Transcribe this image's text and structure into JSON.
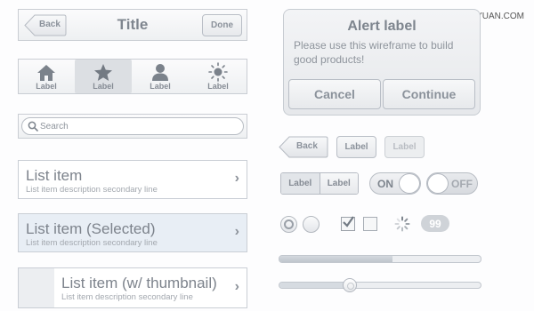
{
  "navbar": {
    "back_label": "Back",
    "title": "Title",
    "done_label": "Done"
  },
  "tabbar": {
    "tabs": [
      {
        "label": "Label",
        "icon": "home-icon"
      },
      {
        "label": "Label",
        "icon": "star-icon"
      },
      {
        "label": "Label",
        "icon": "person-icon"
      },
      {
        "label": "Label",
        "icon": "sun-icon"
      }
    ]
  },
  "search": {
    "placeholder": "Search"
  },
  "list": [
    {
      "title": "List item",
      "subtitle": "List item description secondary line"
    },
    {
      "title": "List item (Selected)",
      "subtitle": "List item description secondary line"
    },
    {
      "title": "List item (w/ thumbnail)",
      "subtitle": "List item description secondary line"
    }
  ],
  "alert": {
    "title": "Alert label",
    "message": "Please use this wireframe to build good products!",
    "cancel_label": "Cancel",
    "continue_label": "Continue"
  },
  "buttons": {
    "back_label": "Back",
    "label": "Label",
    "disabled_label": "Label"
  },
  "segmented": {
    "left": "Label",
    "right": "Label"
  },
  "toggles": {
    "on_label": "ON",
    "off_label": "OFF"
  },
  "badge": {
    "count": "99"
  },
  "checkbox": {
    "checked": true
  },
  "progress": {
    "value": 0.56
  },
  "slider": {
    "value": 0.35
  },
  "watermark": {
    "text": "思缘设计论坛 www.MISSYUAN.COM"
  },
  "colors": {
    "selected_bg": "#e8eef5",
    "text": "#7d838c"
  }
}
